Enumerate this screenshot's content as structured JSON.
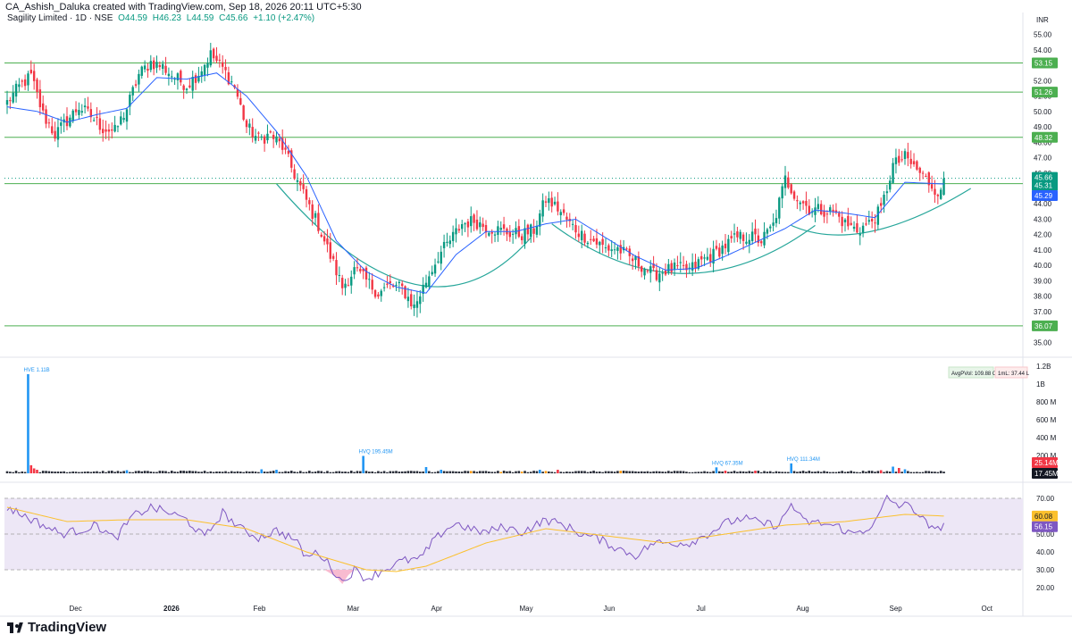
{
  "header": {
    "caption": "CA_Ashish_Daluka created with TradingView.com, Sep 18, 2026 20:11 UTC+5:30"
  },
  "legend": {
    "symbol": "Sagility Limited · 1D · NSE",
    "open": "O44.59",
    "high": "H46.23",
    "low": "L44.59",
    "close": "C45.66",
    "change": "+1.10 (+2.47%)"
  },
  "branding": {
    "name": "TradingView"
  },
  "colors": {
    "up": "#089981",
    "down": "#f23645",
    "ma": "#2962ff",
    "hline": "#4caf50",
    "arc": "#26a69a",
    "rsi": "#7e57c2",
    "rsi_ma": "#fbc02d",
    "rsi_band": "#ede7f6",
    "hvol": "#2196f3",
    "hvol_orange": "#ff9800"
  },
  "chart_data": [
    {
      "type": "candlestick",
      "name": "price",
      "currency_label": "INR",
      "ylim": [
        34.5,
        55.5
      ],
      "y_ticks": [
        35.0,
        36.0,
        37.0,
        38.0,
        39.0,
        40.0,
        41.0,
        42.0,
        43.0,
        44.0,
        45.0,
        46.0,
        47.0,
        48.0,
        49.0,
        50.0,
        51.0,
        52.0,
        53.0,
        54.0,
        55.0
      ],
      "x_ticks": [
        "Dec",
        "2026",
        "Feb",
        "Mar",
        "Apr",
        "May",
        "Jun",
        "Jul",
        "Aug",
        "Sep",
        "Oct"
      ],
      "horizontal_levels": [
        {
          "value": 53.15,
          "label": "53.15"
        },
        {
          "value": 51.26,
          "label": "51.26"
        },
        {
          "value": 48.32,
          "label": "48.32"
        },
        {
          "value": 45.31,
          "label": "45.31"
        },
        {
          "value": 36.07,
          "label": "36.07"
        }
      ],
      "price_tags": [
        {
          "value": 45.66,
          "label": "45.66",
          "color": "#089981"
        },
        {
          "value": 45.31,
          "label": "45.31",
          "color": "#089981"
        },
        {
          "value": 45.29,
          "label": "45.29",
          "color": "#2962ff"
        }
      ],
      "close_anchors": [
        [
          0,
          50.6
        ],
        [
          4,
          51.6
        ],
        [
          8,
          52.3
        ],
        [
          12,
          49.8
        ],
        [
          16,
          48.5
        ],
        [
          20,
          49.4
        ],
        [
          24,
          50.3
        ],
        [
          28,
          49.7
        ],
        [
          32,
          48.9
        ],
        [
          36,
          48.7
        ],
        [
          40,
          50.2
        ],
        [
          44,
          52.4
        ],
        [
          48,
          53.2
        ],
        [
          52,
          52.9
        ],
        [
          56,
          52.2
        ],
        [
          60,
          51.7
        ],
        [
          64,
          52.5
        ],
        [
          68,
          53.7
        ],
        [
          72,
          52.8
        ],
        [
          76,
          51.6
        ],
        [
          80,
          49.0
        ],
        [
          84,
          48.2
        ],
        [
          88,
          48.5
        ],
        [
          92,
          47.7
        ],
        [
          96,
          45.9
        ],
        [
          100,
          44.2
        ],
        [
          104,
          42.6
        ],
        [
          108,
          40.6
        ],
        [
          112,
          38.6
        ],
        [
          116,
          39.7
        ],
        [
          120,
          39.0
        ],
        [
          124,
          38.2
        ],
        [
          128,
          38.7
        ],
        [
          132,
          38.5
        ],
        [
          136,
          37.3
        ],
        [
          140,
          39.0
        ],
        [
          144,
          40.6
        ],
        [
          148,
          41.6
        ],
        [
          152,
          42.7
        ],
        [
          156,
          42.9
        ],
        [
          160,
          42.5
        ],
        [
          164,
          42.3
        ],
        [
          168,
          42.1
        ],
        [
          172,
          42.0
        ],
        [
          176,
          42.3
        ],
        [
          180,
          44.3
        ],
        [
          184,
          43.7
        ],
        [
          188,
          42.7
        ],
        [
          192,
          42.0
        ],
        [
          196,
          41.6
        ],
        [
          200,
          41.1
        ],
        [
          204,
          41.1
        ],
        [
          208,
          40.5
        ],
        [
          212,
          40.0
        ],
        [
          216,
          39.4
        ],
        [
          220,
          39.7
        ],
        [
          224,
          39.8
        ],
        [
          228,
          39.7
        ],
        [
          232,
          40.3
        ],
        [
          236,
          40.7
        ],
        [
          240,
          41.3
        ],
        [
          244,
          41.8
        ],
        [
          248,
          41.9
        ],
        [
          252,
          41.6
        ],
        [
          256,
          42.6
        ],
        [
          260,
          45.6
        ],
        [
          264,
          44.4
        ],
        [
          268,
          43.7
        ],
        [
          272,
          43.6
        ],
        [
          276,
          43.5
        ],
        [
          280,
          42.7
        ],
        [
          284,
          42.3
        ],
        [
          288,
          42.7
        ],
        [
          292,
          43.6
        ],
        [
          296,
          46.5
        ],
        [
          300,
          47.0
        ],
        [
          304,
          46.2
        ],
        [
          308,
          45.4
        ],
        [
          312,
          44.6
        ],
        [
          313,
          45.66
        ]
      ],
      "moving_average_anchors": [
        [
          0,
          50.3
        ],
        [
          10,
          50.0
        ],
        [
          20,
          49.3
        ],
        [
          30,
          49.8
        ],
        [
          40,
          50.2
        ],
        [
          50,
          52.2
        ],
        [
          60,
          52.1
        ],
        [
          70,
          52.5
        ],
        [
          80,
          51.0
        ],
        [
          90,
          48.7
        ],
        [
          100,
          45.8
        ],
        [
          110,
          41.6
        ],
        [
          120,
          39.6
        ],
        [
          130,
          38.6
        ],
        [
          140,
          38.2
        ],
        [
          150,
          40.7
        ],
        [
          160,
          42.2
        ],
        [
          170,
          42.2
        ],
        [
          180,
          42.7
        ],
        [
          190,
          43.0
        ],
        [
          200,
          41.8
        ],
        [
          210,
          40.6
        ],
        [
          220,
          39.7
        ],
        [
          230,
          39.8
        ],
        [
          240,
          40.6
        ],
        [
          250,
          41.5
        ],
        [
          260,
          42.4
        ],
        [
          270,
          43.6
        ],
        [
          280,
          43.4
        ],
        [
          290,
          43.1
        ],
        [
          300,
          45.4
        ],
        [
          313,
          45.29
        ]
      ]
    },
    {
      "type": "bar",
      "name": "volume",
      "y_ticks": [
        "200 M",
        "400 M",
        "600 M",
        "800 M",
        "1B",
        "1.2B"
      ],
      "ylim_millions": [
        0,
        1200
      ],
      "badges": [
        {
          "label": "AvgPVol: 109.88 Cr"
        },
        {
          "label": "1mL: 37.44 L"
        }
      ],
      "high_volume_labels": [
        {
          "index": 7,
          "label": "HVE 1.11B",
          "millions": 1110
        },
        {
          "index": 119,
          "label": "HVQ 195.45M",
          "millions": 195
        },
        {
          "index": 237,
          "label": "HVQ 67.35M",
          "millions": 67
        },
        {
          "index": 262,
          "label": "HVQ 111.34M",
          "millions": 111
        }
      ],
      "value_tags": [
        {
          "label": "25.14M",
          "millions": 25.14,
          "color": "#f23645"
        },
        {
          "label": "17.45M",
          "millions": 17.45,
          "color": "#131722"
        }
      ],
      "orange_bars": [
        155,
        165,
        172,
        180,
        205
      ],
      "other_spikes_millions": [
        [
          8,
          90
        ],
        [
          9,
          55
        ],
        [
          10,
          40
        ],
        [
          40,
          35
        ],
        [
          85,
          45
        ],
        [
          90,
          40
        ],
        [
          140,
          70
        ],
        [
          145,
          40
        ],
        [
          178,
          40
        ],
        [
          184,
          40
        ],
        [
          240,
          30
        ],
        [
          250,
          30
        ],
        [
          292,
          35
        ],
        [
          296,
          75
        ],
        [
          298,
          60
        ],
        [
          300,
          45
        ]
      ]
    },
    {
      "type": "line",
      "name": "rsi",
      "y_ticks": [
        "20.00",
        "30.00",
        "40.00",
        "50.00",
        "60.00",
        "70.00"
      ],
      "ylim": [
        15,
        75
      ],
      "bands": [
        30,
        50,
        70
      ],
      "value_tags": [
        {
          "label": "60.08",
          "value": 60.08,
          "color": "#fbc02d"
        },
        {
          "label": "56.15",
          "value": 56.15,
          "color": "#7e57c2"
        }
      ],
      "rsi_anchors": [
        [
          0,
          65
        ],
        [
          6,
          60
        ],
        [
          12,
          55
        ],
        [
          18,
          50
        ],
        [
          24,
          52
        ],
        [
          30,
          55
        ],
        [
          36,
          47
        ],
        [
          42,
          60
        ],
        [
          48,
          65
        ],
        [
          54,
          62
        ],
        [
          60,
          58
        ],
        [
          66,
          48
        ],
        [
          72,
          62
        ],
        [
          78,
          53
        ],
        [
          84,
          48
        ],
        [
          90,
          52
        ],
        [
          96,
          47
        ],
        [
          100,
          37
        ],
        [
          104,
          40
        ],
        [
          108,
          32
        ],
        [
          112,
          23
        ],
        [
          116,
          30
        ],
        [
          120,
          25
        ],
        [
          126,
          30
        ],
        [
          132,
          35
        ],
        [
          138,
          36
        ],
        [
          142,
          45
        ],
        [
          146,
          52
        ],
        [
          150,
          56
        ],
        [
          156,
          52
        ],
        [
          160,
          51
        ],
        [
          166,
          54
        ],
        [
          172,
          51
        ],
        [
          180,
          58
        ],
        [
          186,
          55
        ],
        [
          192,
          50
        ],
        [
          198,
          47
        ],
        [
          204,
          42
        ],
        [
          210,
          38
        ],
        [
          216,
          45
        ],
        [
          222,
          45
        ],
        [
          228,
          45
        ],
        [
          234,
          50
        ],
        [
          240,
          56
        ],
        [
          246,
          59
        ],
        [
          252,
          56
        ],
        [
          258,
          55
        ],
        [
          262,
          67
        ],
        [
          266,
          57
        ],
        [
          272,
          56
        ],
        [
          278,
          54
        ],
        [
          282,
          50
        ],
        [
          286,
          52
        ],
        [
          290,
          56
        ],
        [
          294,
          70
        ],
        [
          298,
          66
        ],
        [
          302,
          66
        ],
        [
          306,
          58
        ],
        [
          310,
          51
        ],
        [
          313,
          56.15
        ]
      ],
      "rsi_ma_anchors": [
        [
          0,
          65
        ],
        [
          20,
          57
        ],
        [
          40,
          58
        ],
        [
          60,
          58
        ],
        [
          80,
          53
        ],
        [
          100,
          40
        ],
        [
          120,
          30
        ],
        [
          130,
          29
        ],
        [
          140,
          32
        ],
        [
          160,
          45
        ],
        [
          180,
          53
        ],
        [
          200,
          49
        ],
        [
          220,
          45
        ],
        [
          240,
          50
        ],
        [
          260,
          55
        ],
        [
          280,
          57
        ],
        [
          300,
          61
        ],
        [
          313,
          60.08
        ]
      ]
    }
  ]
}
